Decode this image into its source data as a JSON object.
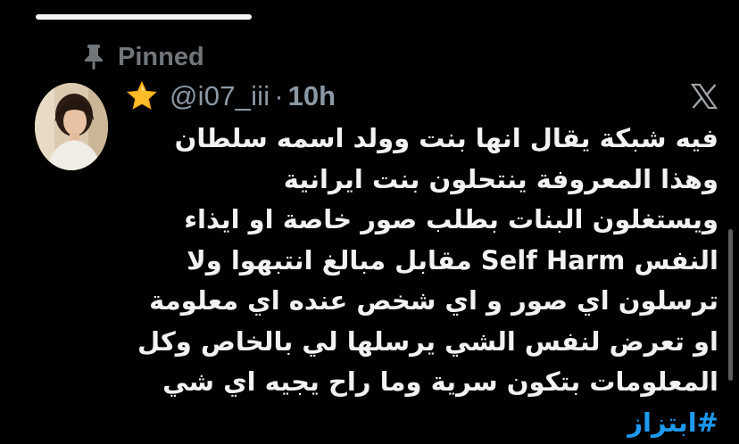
{
  "pinned": {
    "label": "Pinned",
    "icon": "pin-icon"
  },
  "author": {
    "avatar": "avatar",
    "badge_icon": "star-icon",
    "handle": "@i07_iii",
    "separator": "·",
    "time": "10h"
  },
  "platform": {
    "logo": "x-logo-icon"
  },
  "tweet": {
    "lines": [
      "فيه شبكة يقال انها بنت وولد اسمه سلطان",
      "وهذا المعروفة ينتحلون بنت ايرانية",
      "ويستغلون البنات بطلب صور خاصة او ايذاء",
      "النفس Self Harm مقابل مبالغ انتبهوا ولا",
      "ترسلون اي صور  و اي شخص عنده اي معلومة",
      "او تعرض لنفس الشي يرسلها لي بالخاص وكل",
      "المعلومات بتكون سرية وما راح يجيه اي شي"
    ],
    "hashtag": "#ابتزاز"
  },
  "colors": {
    "background": "#000000",
    "text": "#e7e9ea",
    "secondary": "#71767b",
    "link": "#1d9bf0"
  }
}
